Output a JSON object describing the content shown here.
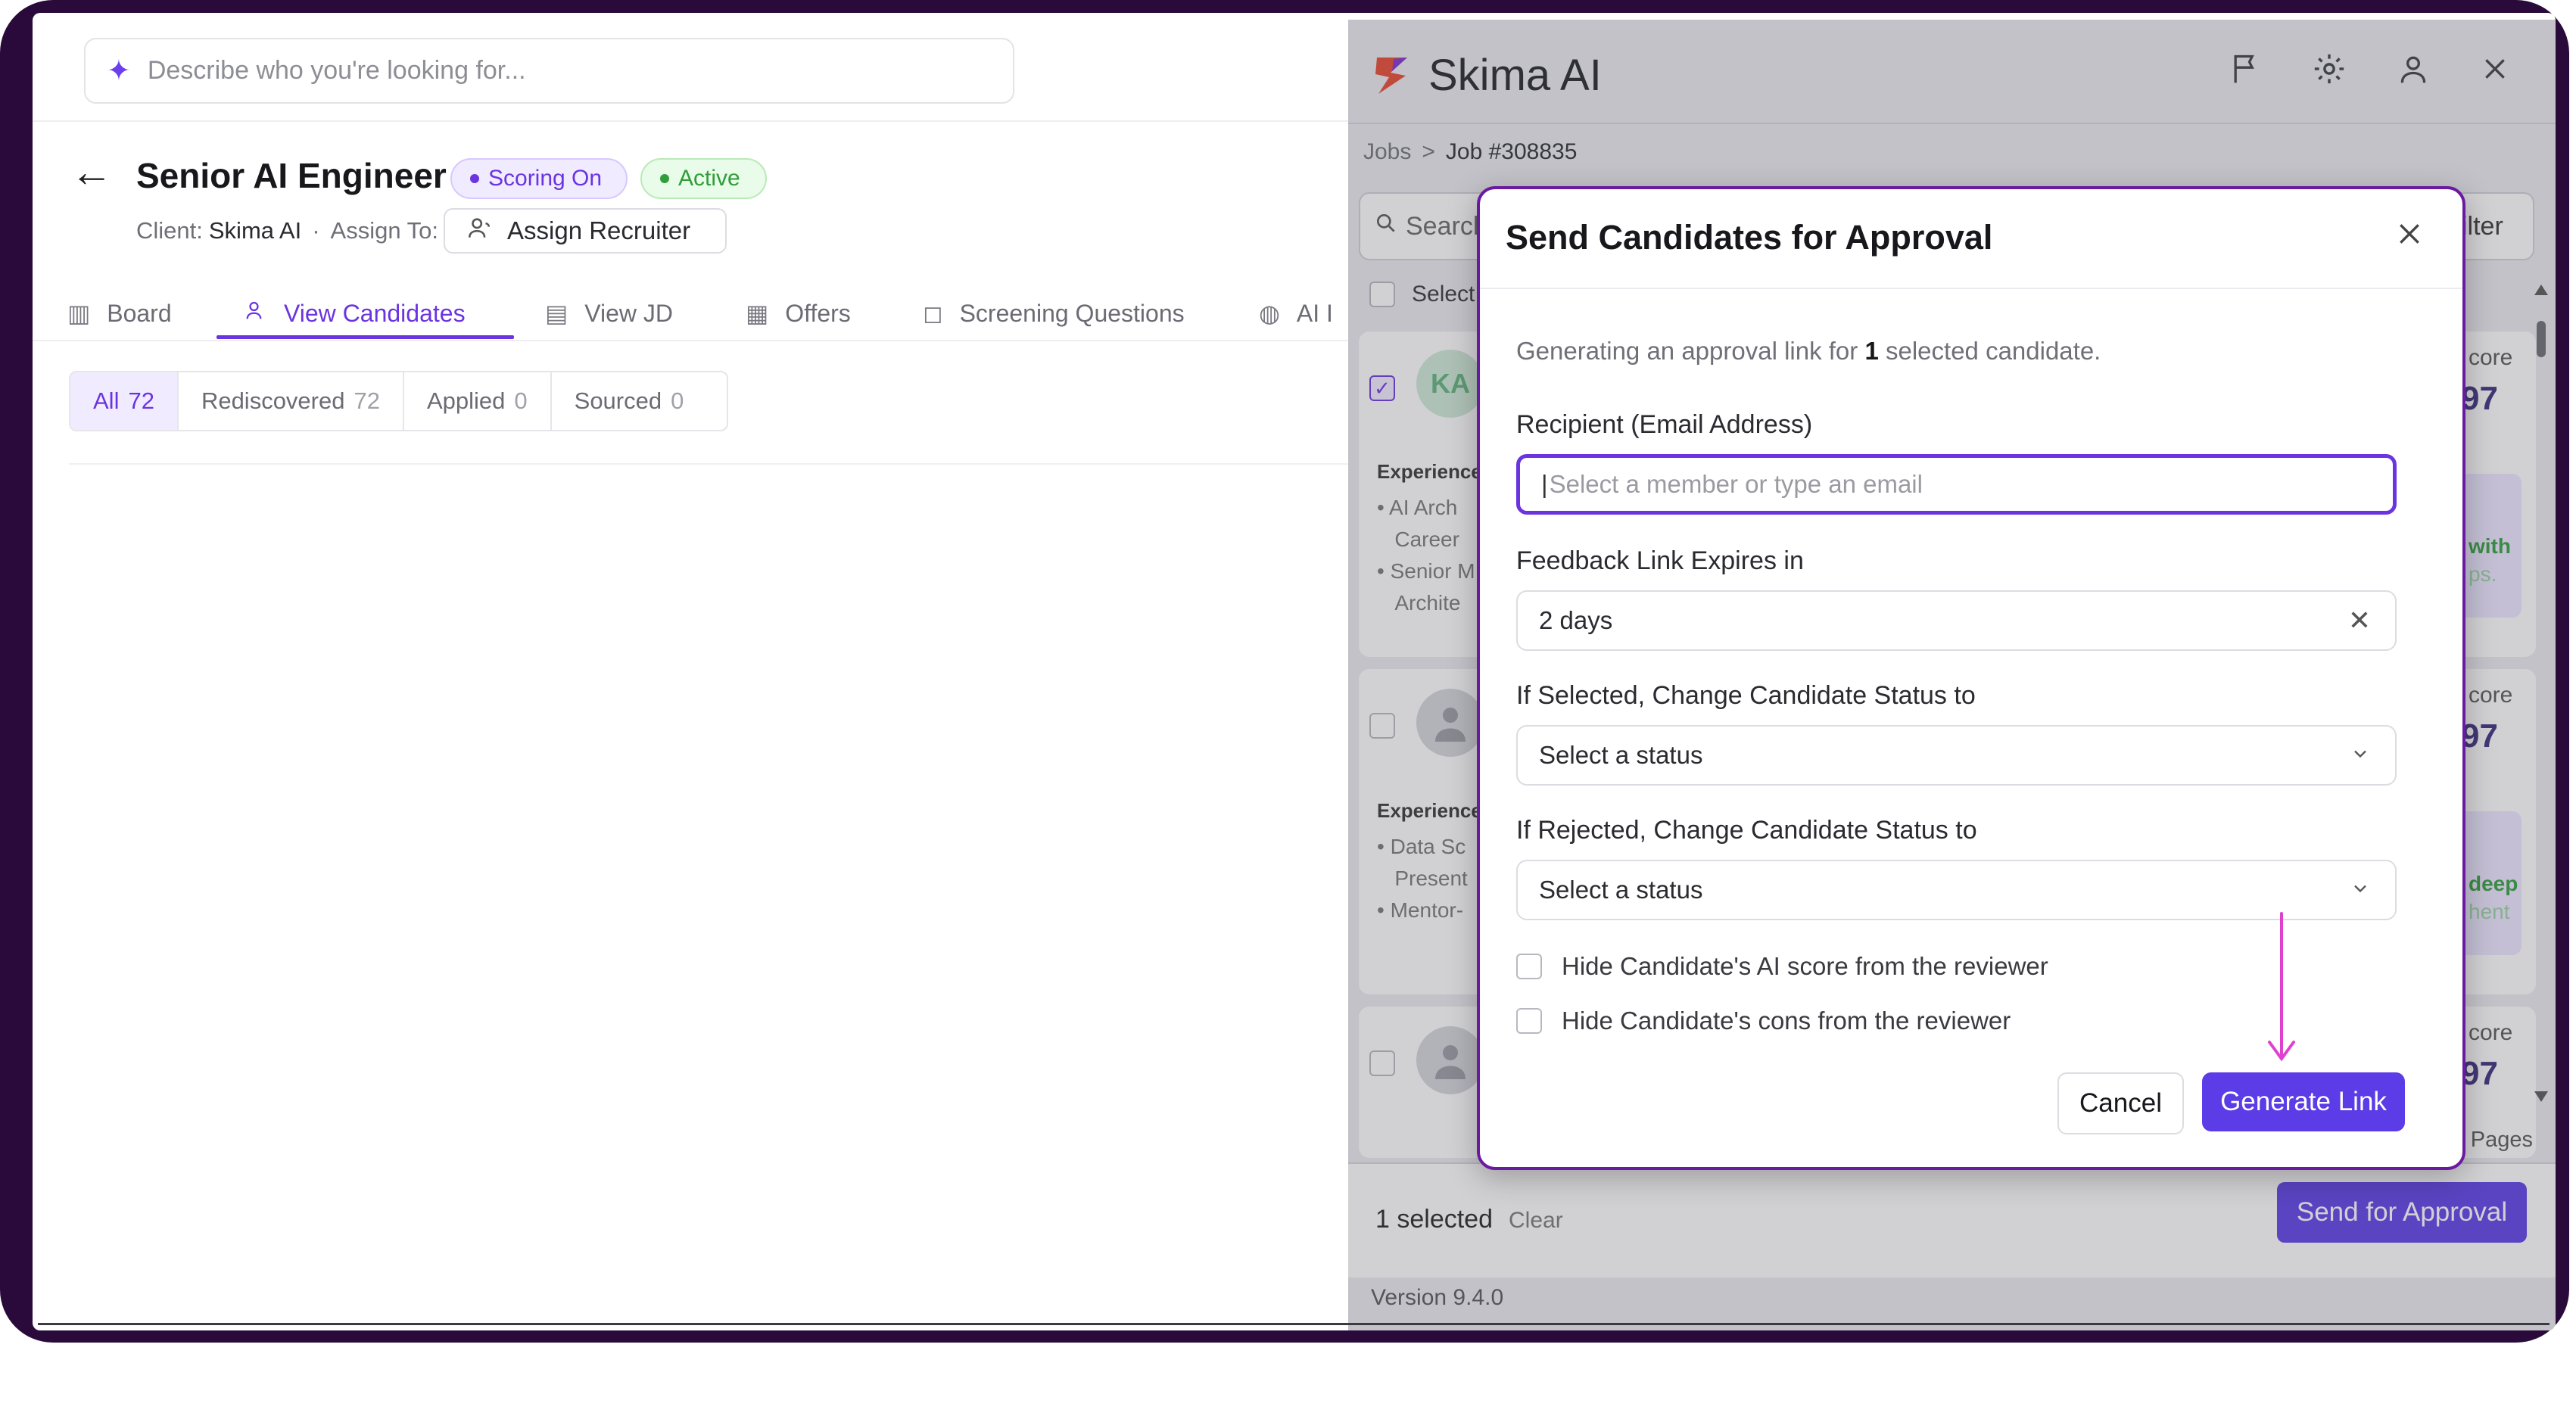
{
  "search": {
    "placeholder": "Describe who you're looking for..."
  },
  "job": {
    "title": "Senior AI Engineer",
    "scoring_badge": "Scoring On",
    "active_badge": "Active",
    "client_label": "Client:",
    "client_value": "Skima AI",
    "separator": "·",
    "assign_label": "Assign To:",
    "assign_button": "Assign Recruiter"
  },
  "tabs": [
    {
      "label": "Board",
      "icon": "board-icon"
    },
    {
      "label": "View Candidates",
      "icon": "users-icon",
      "active": true
    },
    {
      "label": "View JD",
      "icon": "document-icon"
    },
    {
      "label": "Offers",
      "icon": "offer-icon"
    },
    {
      "label": "Screening Questions",
      "icon": "chat-question-icon"
    },
    {
      "label": "AI I",
      "icon": "ai-brain-icon"
    }
  ],
  "filters": [
    {
      "label": "All",
      "count": "72",
      "active": true
    },
    {
      "label": "Rediscovered",
      "count": "72"
    },
    {
      "label": "Applied",
      "count": "0"
    },
    {
      "label": "Sourced",
      "count": "0"
    }
  ],
  "panel": {
    "brand": "Skima AI",
    "icons": [
      "flag-icon",
      "gear-icon",
      "user-icon",
      "close-icon"
    ],
    "breadcrumb": {
      "root": "Jobs",
      "sep": ">",
      "current": "Job #308835"
    },
    "search_text": "Search",
    "filter_label": "Filter",
    "select_all": "Select",
    "score_label": "core",
    "cards": [
      {
        "initials": "KA",
        "score": "97",
        "exp_label": "Experience",
        "bullets": [
          "AI Arch",
          "Career",
          "Senior M",
          "Archite"
        ],
        "pro_text": "with",
        "pro_sub": "ps."
      },
      {
        "initials": "",
        "score": "97",
        "exp_label": "Experience",
        "bullets": [
          "Data Sc",
          "Present",
          "Mentor-"
        ],
        "pro_text": "deep",
        "pro_sub": "hent"
      },
      {
        "initials": "",
        "score": "97"
      }
    ],
    "pages_text": "2 - 1 Pages",
    "selected_count": "1 selected",
    "clear_label": "Clear",
    "send_button": "Send for Approval",
    "version": "Version 9.4.0"
  },
  "modal": {
    "title": "Send Candidates for Approval",
    "desc_prefix": "Generating an approval link for",
    "desc_count": "1",
    "desc_suffix": "selected candidate.",
    "recipient_label": "Recipient (Email Address)",
    "recipient_placeholder": "Select a member or type an email",
    "expires_label": "Feedback Link Expires in",
    "expires_value": "2 days",
    "selected_status_label": "If Selected, Change Candidate Status to",
    "selected_status_value": "Select a status",
    "rejected_status_label": "If Rejected, Change Candidate Status to",
    "rejected_status_value": "Select a status",
    "hide_score_label": "Hide Candidate's AI score from the reviewer",
    "hide_cons_label": "Hide Candidate's cons from the reviewer",
    "cancel_button": "Cancel",
    "generate_button": "Generate Link"
  },
  "colors": {
    "accent": "#6a34e0",
    "primary_button": "#5b3ce6",
    "active_green": "#2f9e3a",
    "annotation_arrow": "#e040d0"
  }
}
